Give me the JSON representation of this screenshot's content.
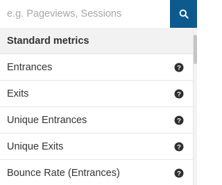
{
  "search": {
    "placeholder": "e.g. Pageviews, Sessions",
    "button_icon": "search-icon",
    "button_color": "#0c5a8e"
  },
  "section": {
    "title": "Standard metrics"
  },
  "items": [
    {
      "label": "Entrances",
      "icon": "help-icon"
    },
    {
      "label": "Exits",
      "icon": "help-icon"
    },
    {
      "label": "Unique Entrances",
      "icon": "help-icon"
    },
    {
      "label": "Unique Exits",
      "icon": "help-icon"
    },
    {
      "label": "Bounce Rate (Entrances)",
      "icon": "help-icon"
    }
  ]
}
